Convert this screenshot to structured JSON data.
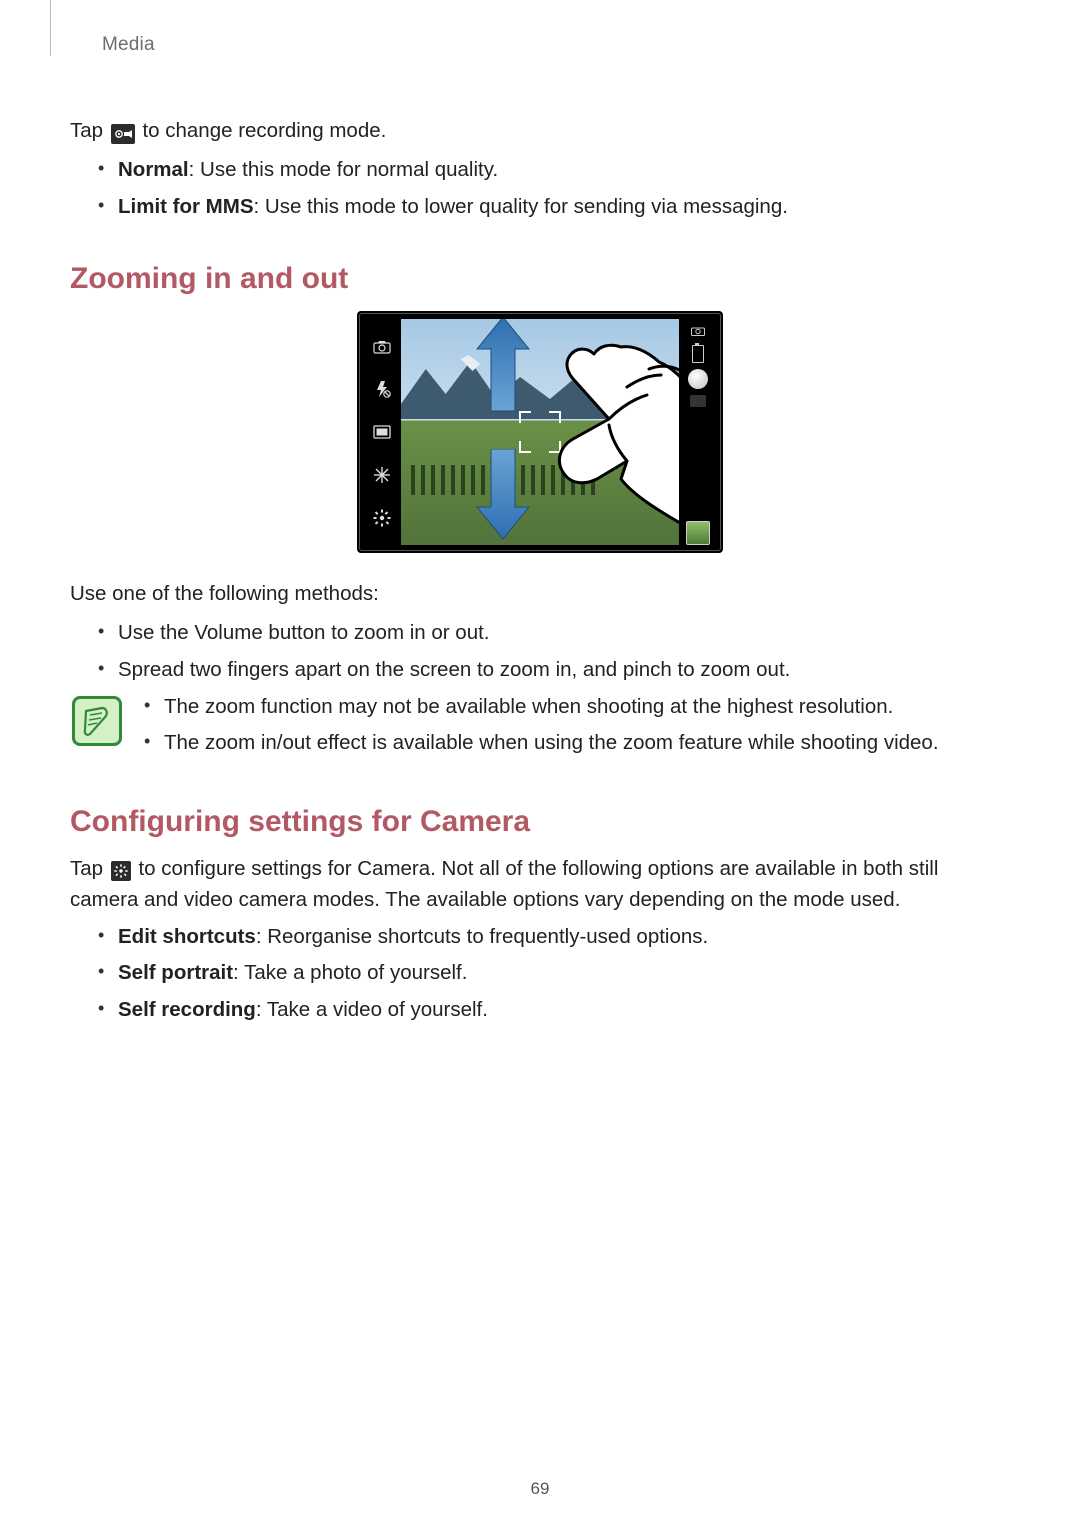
{
  "header": {
    "section": "Media"
  },
  "tap_line": {
    "before": "Tap ",
    "after": " to change recording mode.",
    "icon": "recording-mode-icon"
  },
  "modes": [
    {
      "name": "Normal",
      "desc": ": Use this mode for normal quality."
    },
    {
      "name": "Limit for MMS",
      "desc": ": Use this mode to lower quality for sending via messaging."
    }
  ],
  "zoom_heading": "Zooming in and out",
  "zoom_methods_intro": "Use one of the following methods:",
  "zoom_methods": [
    "Use the Volume button to zoom in or out.",
    "Spread two fingers apart on the screen to zoom in, and pinch to zoom out."
  ],
  "zoom_notes": [
    "The zoom function may not be available when shooting at the highest resolution.",
    "The zoom in/out effect is available when using the zoom feature while shooting video."
  ],
  "settings_heading": "Configuring settings for Camera",
  "settings_para": {
    "before": "Tap ",
    "after": " to configure settings for Camera. Not all of the following options are available in both still camera and video camera modes. The available options vary depending on the mode used.",
    "icon": "settings-gear-icon"
  },
  "settings_list": [
    {
      "name": "Edit shortcuts",
      "desc": ": Reorganise shortcuts to frequently-used options."
    },
    {
      "name": "Self portrait",
      "desc": ": Take a photo of yourself."
    },
    {
      "name": "Self recording",
      "desc": ": Take a video of yourself."
    }
  ],
  "page_number": "69",
  "colors": {
    "accent": "#b25964"
  }
}
